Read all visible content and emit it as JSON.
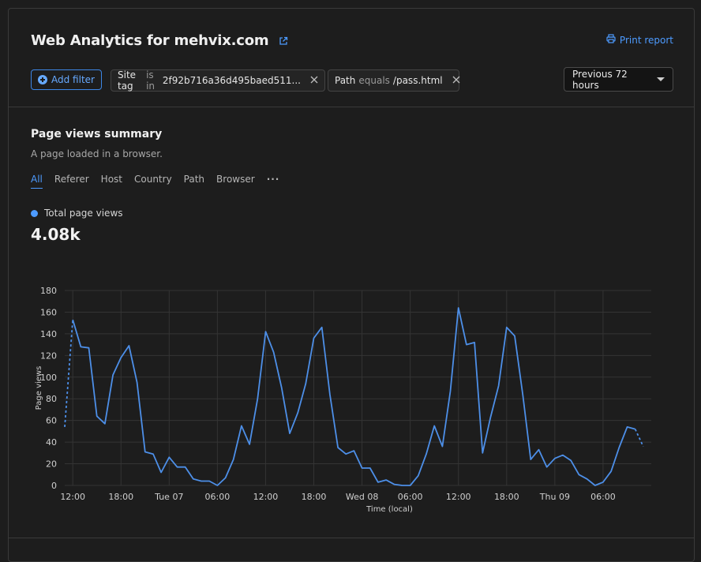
{
  "header": {
    "title": "Web Analytics for mehvix.com",
    "print_label": "Print report",
    "add_filter_label": "Add filter",
    "filters": [
      {
        "key": "Site tag",
        "op": "is in",
        "value": "2f92b716a36d495baed511..."
      },
      {
        "key": "Path",
        "op": "equals",
        "value": "/pass.html"
      }
    ],
    "time_range": "Previous 72 hours"
  },
  "summary": {
    "title": "Page views summary",
    "subtitle": "A page loaded in a browser.",
    "tabs": [
      "All",
      "Referer",
      "Host",
      "Country",
      "Path",
      "Browser"
    ],
    "active_tab": "All",
    "legend_label": "Total page views",
    "total": "4.08k"
  },
  "colors": {
    "accent": "#4d9bff",
    "line": "#4d8fe8"
  },
  "chart_data": {
    "type": "line",
    "title": "",
    "xlabel": "Time (local)",
    "ylabel": "Page views",
    "ylim": [
      0,
      180
    ],
    "yticks": [
      0,
      20,
      40,
      60,
      80,
      100,
      120,
      140,
      160,
      180
    ],
    "xtick_labels": [
      "12:00",
      "18:00",
      "Tue 07",
      "06:00",
      "12:00",
      "18:00",
      "Wed 08",
      "06:00",
      "12:00",
      "18:00",
      "Thu 09",
      "06:00"
    ],
    "grid": true,
    "x_range_hours": [
      -1,
      72
    ],
    "series": [
      {
        "values": [
          54,
          153,
          128,
          127,
          64,
          57,
          102,
          118,
          129,
          95,
          31,
          29,
          12,
          26,
          17,
          17,
          6,
          4,
          4,
          0,
          7,
          24,
          55,
          38,
          80,
          142,
          123,
          90,
          48,
          67,
          94,
          136,
          146,
          84,
          35,
          29,
          32,
          16,
          16,
          3,
          5,
          1,
          0,
          0,
          9,
          29,
          55,
          36,
          87,
          164,
          130,
          132,
          30,
          63,
          92,
          146,
          138,
          84,
          24,
          33,
          17,
          25,
          28,
          23,
          10,
          6,
          0,
          3,
          13,
          35,
          54,
          52,
          36
        ],
        "dashed_first_segment": true,
        "dashed_last_segment": true
      }
    ]
  }
}
